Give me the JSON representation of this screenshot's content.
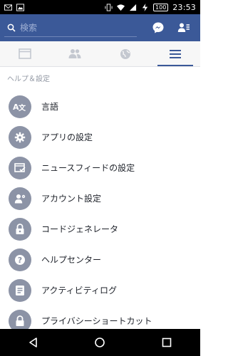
{
  "status_bar": {
    "battery": "100",
    "time": "23:53"
  },
  "search": {
    "placeholder": "検索"
  },
  "section": {
    "title": "ヘルプ＆設定"
  },
  "menu": {
    "items": [
      {
        "label": "言語",
        "icon": "translate-icon"
      },
      {
        "label": "アプリの設定",
        "icon": "gear-icon"
      },
      {
        "label": "ニュースフィードの設定",
        "icon": "news-feed-icon"
      },
      {
        "label": "アカウント設定",
        "icon": "account-icon"
      },
      {
        "label": "コードジェネレータ",
        "icon": "lock-icon"
      },
      {
        "label": "ヘルプセンター",
        "icon": "question-icon"
      },
      {
        "label": "アクティビティログ",
        "icon": "list-icon"
      },
      {
        "label": "プライバシーショートカット",
        "icon": "lock-icon"
      }
    ]
  },
  "colors": {
    "brand": "#3b5998",
    "icon_bg": "#8c93a6",
    "text": "#1d2129",
    "muted": "#9197a3"
  }
}
